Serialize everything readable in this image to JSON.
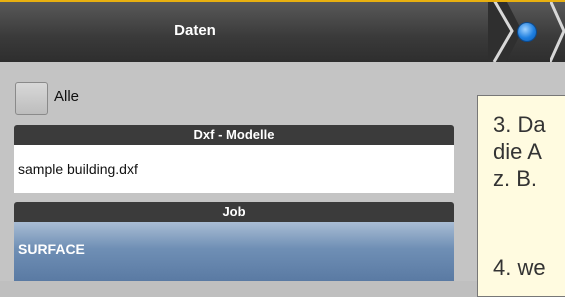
{
  "header": {
    "title": "Daten",
    "step_color": "#1e7fe0"
  },
  "select_all": {
    "label": "Alle",
    "checked": false
  },
  "dxf_section": {
    "title": "Dxf - Modelle",
    "items": [
      "sample building.dxf"
    ]
  },
  "job_section": {
    "title": "Job",
    "items": [
      "SURFACE"
    ]
  },
  "note": {
    "lines": [
      "3. Da",
      "die A",
      "z. B.",
      "4. we"
    ]
  }
}
